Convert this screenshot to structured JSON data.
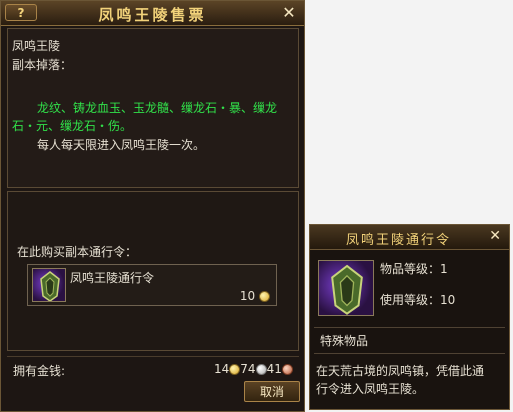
{
  "window": {
    "title": "凤鸣王陵售票",
    "help_label": "?",
    "close_label": "✕"
  },
  "info": {
    "name": "凤鸣王陵",
    "drops_label": "副本掉落：",
    "drops_line1": "龙纹、铸龙血玉、玉龙髓、缫龙石・暴、缫龙",
    "drops_line2": "石・元、缫龙石・伤。",
    "limit_text": "每人每天限进入凤鸣王陵一次。"
  },
  "buy": {
    "label": "在此购买副本通行令：",
    "item_name": "凤鸣王陵通行令",
    "item_price": "10"
  },
  "money": {
    "label": "拥有金钱:",
    "gold": "14",
    "silver": "74",
    "copper": "41"
  },
  "cancel_label": "取消",
  "tooltip": {
    "title": "凤鸣王陵通行令",
    "close_label": "✕",
    "item_level": "物品等级：1",
    "use_level": "使用等级：10",
    "category": "特殊物品",
    "desc_line1": "在天荒古境的凤鸣镇，凭借此通",
    "desc_line2": "行令进入凤鸣王陵。"
  },
  "colors": {
    "title_gold": "#f2d27a",
    "drop_green": "#31e14a",
    "frame_brown": "#6b5636"
  },
  "icons": [
    "help-icon",
    "close-icon",
    "pass-token-icon",
    "gold-coin-icon",
    "silver-coin-icon",
    "copper-coin-icon"
  ]
}
